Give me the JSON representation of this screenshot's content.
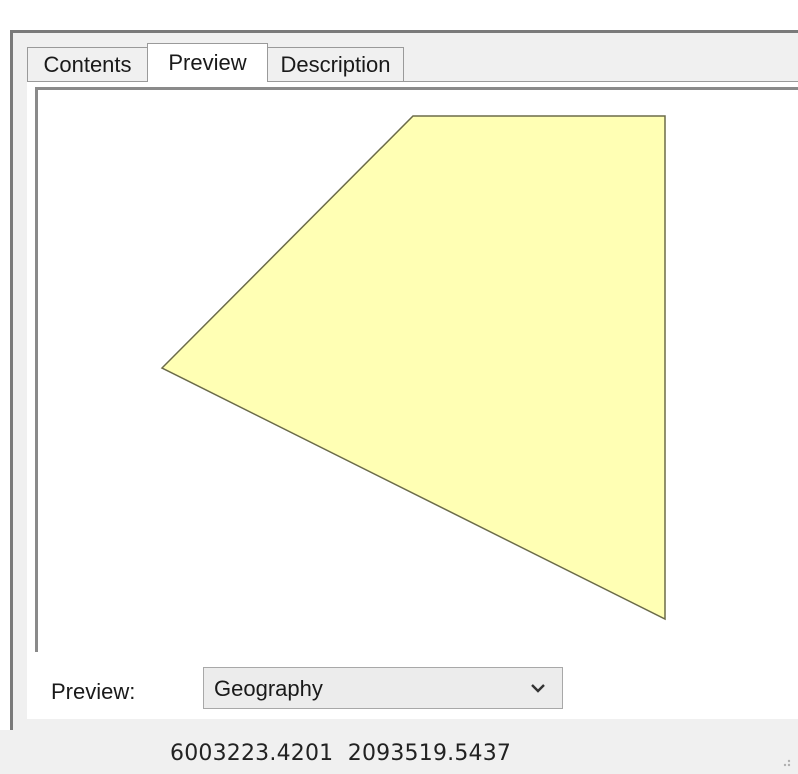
{
  "tabs": [
    {
      "label": "Contents",
      "active": false
    },
    {
      "label": "Preview",
      "active": true
    },
    {
      "label": "Description",
      "active": false
    }
  ],
  "preview": {
    "feature_fill": "#ffffb4",
    "feature_stroke": "#6b6b4a"
  },
  "bottom": {
    "preview_label": "Preview:",
    "preview_select": {
      "selected": "Geography"
    }
  },
  "status": {
    "x": "6003223.4201",
    "y": "2093519.5437"
  }
}
